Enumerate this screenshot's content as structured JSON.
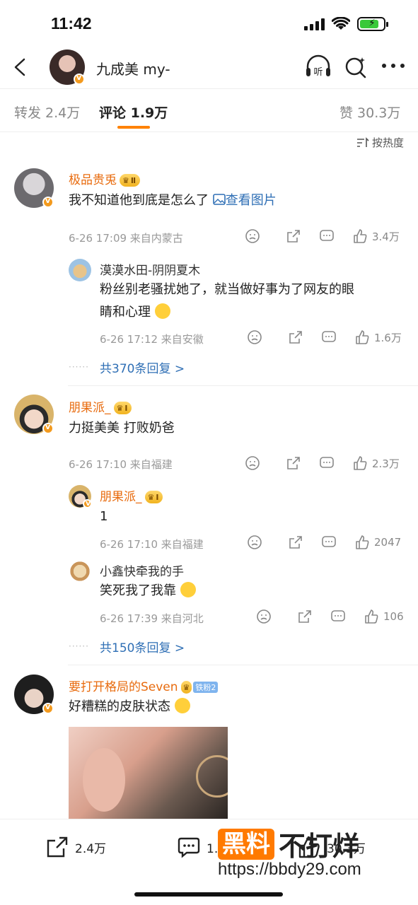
{
  "status_bar": {
    "time": "11:42"
  },
  "nav": {
    "title": "九成美 my-",
    "listen_label": "听"
  },
  "tabs": [
    {
      "label": "转发 2.4万"
    },
    {
      "label": "评论 1.9万"
    },
    {
      "label": "赞 30.3万"
    }
  ],
  "sort_label": "按热度",
  "comments": [
    {
      "user": "极品贵兎",
      "crown_level": "Ⅱ",
      "text": "我不知道他到底是怎么了",
      "view_image": "查看图片",
      "meta": "6-26 17:09  来自内蒙古",
      "likes": "3.4万",
      "replies": [
        {
          "user": "漠漠水田-阴阴夏木",
          "text_line1": "粉丝别老骚扰她了，就当做好事为了网友的眼",
          "text_line2": "睛和心理",
          "meta": "6-26 17:12  来自安徽",
          "likes": "1.6万"
        }
      ],
      "more_replies": "共370条回复 >"
    },
    {
      "user": "朋果派_",
      "crown_level": "Ⅰ",
      "text": "力挺美美 打败奶爸",
      "meta": "6-26 17:10  来自福建",
      "likes": "2.3万",
      "replies": [
        {
          "user": "朋果派_",
          "crown_level": "Ⅰ",
          "text": "1",
          "meta": "6-26 17:10  来自福建",
          "likes": "2047"
        },
        {
          "user": "小鑫快牵我的手",
          "text": "笑死我了我靠",
          "meta": "6-26 17:39  来自河北",
          "likes": "106"
        }
      ],
      "more_replies": "共150条回复 >"
    },
    {
      "user": "要打开格局的Seven",
      "fan_badge": "铁粉2",
      "text": "好糟糕的皮肤状态"
    }
  ],
  "bottom_bar": {
    "repost_count": "2.4万",
    "comment_count": "1.9万",
    "like_count": "30.3万"
  },
  "watermark": {
    "box": "黑料",
    "text": "不打烊",
    "url": "https://bbdy29.com"
  },
  "colors": {
    "accent": "#ff8200",
    "username": "#e86b0e",
    "link": "#2f6fb5"
  }
}
